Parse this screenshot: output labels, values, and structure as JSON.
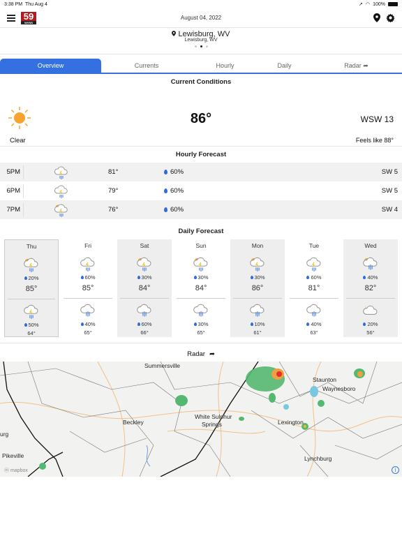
{
  "status_bar": {
    "time": "3:38 PM",
    "day": "Thu Aug 4",
    "battery": "100%"
  },
  "header": {
    "logo_number": "59",
    "logo_sub": "WVNS",
    "date": "August 04, 2022"
  },
  "location": {
    "city": "Lewisburg, WV",
    "subtitle": "Lewisburg, WV",
    "page_dots": 3,
    "active_dot": 2
  },
  "tabs": [
    {
      "label": "Overview",
      "active": true
    },
    {
      "label": "Currents",
      "active": false
    },
    {
      "label": "Hourly",
      "active": false
    },
    {
      "label": "Daily",
      "active": false
    },
    {
      "label": "Radar",
      "active": false,
      "icon": "share-icon"
    }
  ],
  "current_conditions": {
    "title": "Current Conditions",
    "icon": "sun-icon",
    "condition": "Clear",
    "temperature": "86°",
    "wind": "WSW 13",
    "feels_like": "Feels like 88°"
  },
  "hourly": {
    "title": "Hourly Forecast",
    "rows": [
      {
        "time": "5PM",
        "icon": "thunderstorm-icon",
        "temp": "81°",
        "precip": "60%",
        "wind": "SW 5"
      },
      {
        "time": "6PM",
        "icon": "thunderstorm-icon",
        "temp": "79°",
        "precip": "60%",
        "wind": "SW 5"
      },
      {
        "time": "7PM",
        "icon": "partly-sunny-thunderstorm-icon",
        "temp": "76°",
        "precip": "60%",
        "wind": "SW 4"
      }
    ]
  },
  "daily": {
    "title": "Daily Forecast",
    "days": [
      {
        "name": "Thu",
        "day_icon": "partly-sunny-thunderstorm-icon",
        "day_precip": "20%",
        "high": "85°",
        "night_icon": "night-thunderstorm-icon",
        "night_precip": "50%",
        "low": "64°"
      },
      {
        "name": "Fri",
        "day_icon": "thunderstorm-icon",
        "day_precip": "60%",
        "high": "85°",
        "night_icon": "rain-icon",
        "night_precip": "40%",
        "low": "65°"
      },
      {
        "name": "Sat",
        "day_icon": "partly-sunny-thunderstorm-icon",
        "day_precip": "30%",
        "high": "84°",
        "night_icon": "night-rain-icon",
        "night_precip": "60%",
        "low": "66°"
      },
      {
        "name": "Sun",
        "day_icon": "partly-sunny-thunderstorm-icon",
        "day_precip": "30%",
        "high": "84°",
        "night_icon": "rain-icon",
        "night_precip": "30%",
        "low": "65°"
      },
      {
        "name": "Mon",
        "day_icon": "partly-sunny-thunderstorm-icon",
        "day_precip": "30%",
        "high": "86°",
        "night_icon": "rain-icon",
        "night_precip": "10%",
        "low": "61°"
      },
      {
        "name": "Tue",
        "day_icon": "thunderstorm-icon",
        "day_precip": "60%",
        "high": "81°",
        "night_icon": "rain-icon",
        "night_precip": "40%",
        "low": "63°"
      },
      {
        "name": "Wed",
        "day_icon": "partly-sunny-rain-icon",
        "day_precip": "40%",
        "high": "82°",
        "night_icon": "night-cloudy-icon",
        "night_precip": "20%",
        "low": "56°"
      }
    ]
  },
  "radar": {
    "title": "Radar",
    "attribution": "mapbox",
    "labels": [
      "Summersville",
      "Beckley",
      "White Sulphur",
      "Springs",
      "Lexington",
      "Staunton",
      "Waynesboro",
      "Lynchburg",
      "Pikeville",
      "urg"
    ]
  },
  "colors": {
    "accent": "#3470e0",
    "logo_red": "#b01c24",
    "sun": "#f7a330",
    "precip_drop": "#2f6be0"
  }
}
